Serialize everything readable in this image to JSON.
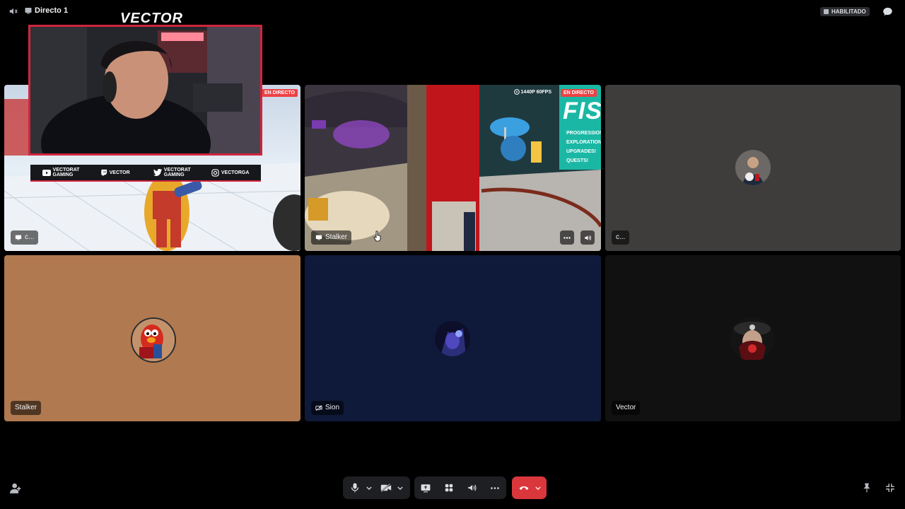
{
  "topbar": {
    "channel_title": "Directo 1",
    "badge_label": "HABILITADO"
  },
  "overlay": {
    "logo_text": "VECTOR",
    "socials": [
      {
        "icon": "youtube-icon",
        "label": "VECTORAT GAMING"
      },
      {
        "icon": "twitch-icon",
        "label": "VECTOR"
      },
      {
        "icon": "twitter-icon",
        "label": "VECTORAT GAMING"
      },
      {
        "icon": "instagram-icon",
        "label": "VECTORGA"
      }
    ]
  },
  "tiles": [
    {
      "id": "tile-1",
      "label": "c...",
      "live": "EN DIRECTO",
      "kind": "screen-share"
    },
    {
      "id": "tile-2",
      "label": "Stalker",
      "live": "EN DIRECTO",
      "quality": "1440P 60FPS",
      "kind": "screen-share",
      "game_text": "FISH",
      "game_menu": [
        "PROGRESSION",
        "EXPLORATION",
        "UPGRADES!",
        "QUESTS!"
      ]
    },
    {
      "id": "tile-3",
      "label": "c...",
      "kind": "avatar",
      "bg": "#3e3d3c"
    },
    {
      "id": "tile-4",
      "label": "Stalker",
      "kind": "avatar",
      "bg": "#b0794f"
    },
    {
      "id": "tile-5",
      "label": "Sion",
      "kind": "avatar",
      "bg": "#0f1a3a"
    },
    {
      "id": "tile-6",
      "label": "Vector",
      "kind": "avatar",
      "bg": "#111111"
    }
  ],
  "colors": {
    "accent_red": "#ed4245",
    "hangup_red": "#da373c",
    "control_bg": "#1e1f22"
  }
}
